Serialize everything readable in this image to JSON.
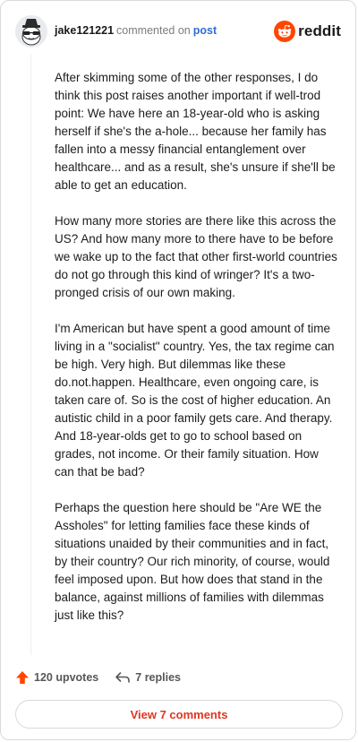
{
  "header": {
    "username": "jake121221",
    "action_text": "commented on",
    "post_link": "post",
    "brand": "reddit"
  },
  "comment": {
    "paragraphs": [
      "After skimming some of the other responses, I do think this post raises another important if well-trod point: We have here an 18-year-old who is asking herself if she's the a-hole... because her family has fallen into a messy financial entanglement over healthcare... and as a result, she's unsure if she'll be able to get an education.",
      "How many more stories are there like this across the US? And how many more to there have to be before we wake up to the fact that other first-world countries do not go through this kind of wringer? It's a two-pronged crisis of our own making.",
      "I'm American but have spent a good amount of time living in a \"socialist\" country. Yes, the tax regime can be high. Very high. But dilemmas like these do.not.happen. Healthcare, even ongoing care, is taken care of. So is the cost of higher education. An autistic child in a poor family gets care. And therapy. And 18-year-olds get to go to school based on grades, not income. Or their family situation. How can that be bad?",
      "Perhaps the question here should be \"Are WE the Assholes\" for letting families face these kinds of situations unaided by their communities and in fact, by their country? Our rich minority, of course, would feel imposed upon. But how does that stand in the balance, against millions of families with dilemmas just like this?"
    ]
  },
  "actions": {
    "upvotes": "120 upvotes",
    "replies": "7 replies"
  },
  "footer": {
    "view_comments": "View 7 comments"
  },
  "icons": {
    "upvote": "upvote-arrow-icon",
    "reply": "reply-arrow-icon",
    "brand_logo": "reddit-snoo-icon",
    "avatar": "snoo-avatar-icon"
  },
  "colors": {
    "upvote": "#ff4500",
    "brand": "#ff4500",
    "link": "#2f6fd6",
    "view_button_text": "#e0361f"
  }
}
